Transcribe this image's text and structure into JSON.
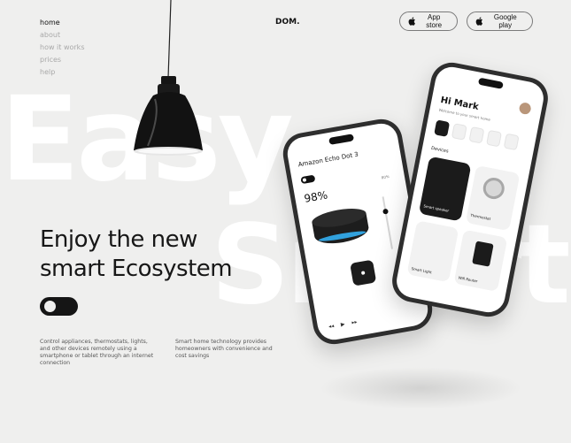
{
  "background_words": [
    "Easy",
    "Smart"
  ],
  "nav": {
    "items": [
      "home",
      "about",
      "how it works",
      "prices",
      "help"
    ],
    "active": "home"
  },
  "brand": {
    "logo": "DOM."
  },
  "store_buttons": {
    "app_store": "App store",
    "google_play": "Google play"
  },
  "hero": {
    "headline_line1": "Enjoy the new",
    "headline_line2": "smart Ecosystem",
    "toggle_state": "off"
  },
  "descriptions": [
    "Control appliances, thermostats, lights, and other devices remotely using a smartphone or tablet through an internet connection",
    "Smart home technology provides homeowners with convenience and cost savings"
  ],
  "phone_left": {
    "title": "Amazon Echo Dot 3",
    "percent": "98%",
    "side_value": "80%"
  },
  "phone_right": {
    "greeting": "Hi Mark",
    "welcome": "Welcome to your smart home",
    "section": "Devices",
    "tiles": [
      "Smart speaker",
      "Thermostat",
      "Smart Light",
      "Wifi Router"
    ]
  },
  "colors": {
    "background": "#efefee",
    "text": "#171717",
    "muted_nav": "#a9a9a9",
    "accent_ring": "#35b8ff"
  }
}
